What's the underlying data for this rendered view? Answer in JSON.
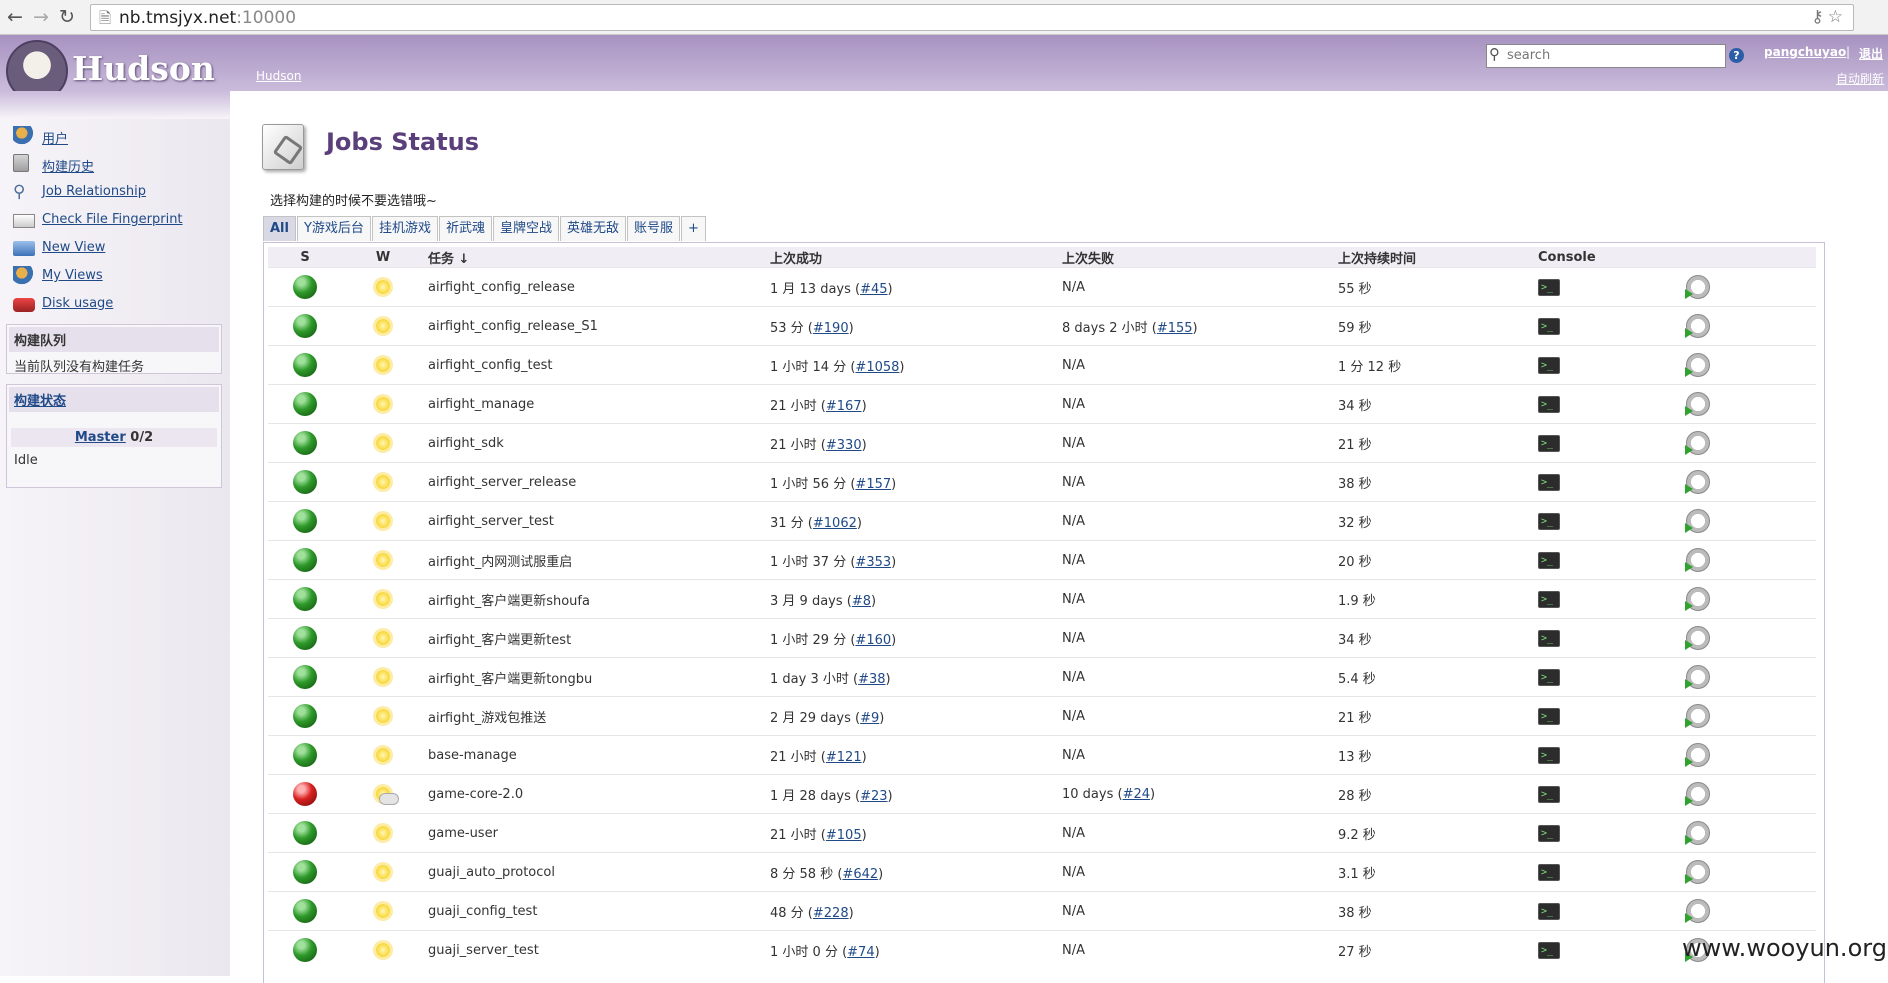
{
  "browser": {
    "url_host": "nb.tmsjyx.net",
    "url_port": ":10000"
  },
  "header": {
    "logo_text": "Hudson",
    "breadcrumb": "Hudson",
    "search_placeholder": "search",
    "user": "pangchuyao",
    "separator": "|",
    "logout": "退出",
    "auto_refresh": "自动刷新"
  },
  "sidebar": {
    "tasks": [
      {
        "label": "用户",
        "icon": "users-icon"
      },
      {
        "label": "构建历史",
        "icon": "build-history-icon"
      },
      {
        "label": "Job Relationship",
        "icon": "search-icon"
      },
      {
        "label": "Check File Fingerprint",
        "icon": "fingerprint-icon"
      },
      {
        "label": "New View",
        "icon": "folder-icon"
      },
      {
        "label": "My Views",
        "icon": "users-icon"
      },
      {
        "label": "Disk usage",
        "icon": "disk-icon"
      }
    ],
    "queue": {
      "title": "构建队列",
      "empty": "当前队列没有构建任务"
    },
    "executors": {
      "title": "构建状态",
      "master": "Master",
      "master_count": "0/2",
      "status": "Idle"
    }
  },
  "main": {
    "title": "Jobs Status",
    "description": "选择构建的时候不要选错哦~",
    "tabs": [
      "All",
      "Y游戏后台",
      "挂机游戏",
      "祈武魂",
      "皇牌空战",
      "英雄无敌",
      "账号服",
      "+"
    ],
    "columns": [
      "S",
      "W",
      "任务 ↓",
      "上次成功",
      "上次失败",
      "上次持续时间",
      "Console"
    ],
    "rows": [
      {
        "status": "blue",
        "weather": "sunny",
        "name": "airfight_config_release",
        "success": "1 月 13 days (",
        "success_build": "#45",
        "failure": "N/A",
        "failure_build": "",
        "duration": "55 秒"
      },
      {
        "status": "blue",
        "weather": "sunny",
        "name": "airfight_config_release_S1",
        "success": "53 分 (",
        "success_build": "#190",
        "failure": "8 days 2 小时 (",
        "failure_build": "#155",
        "duration": "59 秒"
      },
      {
        "status": "blue",
        "weather": "sunny",
        "name": "airfight_config_test",
        "success": "1 小时 14 分 (",
        "success_build": "#1058",
        "failure": "N/A",
        "failure_build": "",
        "duration": "1 分 12 秒"
      },
      {
        "status": "blue",
        "weather": "sunny",
        "name": "airfight_manage",
        "success": "21 小时 (",
        "success_build": "#167",
        "failure": "N/A",
        "failure_build": "",
        "duration": "34 秒"
      },
      {
        "status": "blue",
        "weather": "sunny",
        "name": "airfight_sdk",
        "success": "21 小时 (",
        "success_build": "#330",
        "failure": "N/A",
        "failure_build": "",
        "duration": "21 秒"
      },
      {
        "status": "blue",
        "weather": "sunny",
        "name": "airfight_server_release",
        "success": "1 小时 56 分 (",
        "success_build": "#157",
        "failure": "N/A",
        "failure_build": "",
        "duration": "38 秒"
      },
      {
        "status": "blue",
        "weather": "sunny",
        "name": "airfight_server_test",
        "success": "31 分 (",
        "success_build": "#1062",
        "failure": "N/A",
        "failure_build": "",
        "duration": "32 秒"
      },
      {
        "status": "blue",
        "weather": "sunny",
        "name": "airfight_内网测试服重启",
        "success": "1 小时 37 分 (",
        "success_build": "#353",
        "failure": "N/A",
        "failure_build": "",
        "duration": "20 秒"
      },
      {
        "status": "blue",
        "weather": "sunny",
        "name": "airfight_客户端更新shoufa",
        "success": "3 月 9 days (",
        "success_build": "#8",
        "failure": "N/A",
        "failure_build": "",
        "duration": "1.9 秒"
      },
      {
        "status": "blue",
        "weather": "sunny",
        "name": "airfight_客户端更新test",
        "success": "1 小时 29 分 (",
        "success_build": "#160",
        "failure": "N/A",
        "failure_build": "",
        "duration": "34 秒"
      },
      {
        "status": "blue",
        "weather": "sunny",
        "name": "airfight_客户端更新tongbu",
        "success": "1 day 3 小时 (",
        "success_build": "#38",
        "failure": "N/A",
        "failure_build": "",
        "duration": "5.4 秒"
      },
      {
        "status": "blue",
        "weather": "sunny",
        "name": "airfight_游戏包推送",
        "success": "2 月 29 days (",
        "success_build": "#9",
        "failure": "N/A",
        "failure_build": "",
        "duration": "21 秒"
      },
      {
        "status": "blue",
        "weather": "sunny",
        "name": "base-manage",
        "success": "21 小时 (",
        "success_build": "#121",
        "failure": "N/A",
        "failure_build": "",
        "duration": "13 秒"
      },
      {
        "status": "red",
        "weather": "partly-cloudy",
        "name": "game-core-2.0",
        "success": "1 月 28 days (",
        "success_build": "#23",
        "failure": "10 days (",
        "failure_build": "#24",
        "duration": "28 秒"
      },
      {
        "status": "blue",
        "weather": "sunny",
        "name": "game-user",
        "success": "21 小时 (",
        "success_build": "#105",
        "failure": "N/A",
        "failure_build": "",
        "duration": "9.2 秒"
      },
      {
        "status": "blue",
        "weather": "sunny",
        "name": "guaji_auto_protocol",
        "success": "8 分 58 秒 (",
        "success_build": "#642",
        "failure": "N/A",
        "failure_build": "",
        "duration": "3.1 秒"
      },
      {
        "status": "blue",
        "weather": "sunny",
        "name": "guaji_config_test",
        "success": "48 分 (",
        "success_build": "#228",
        "failure": "N/A",
        "failure_build": "",
        "duration": "38 秒"
      },
      {
        "status": "blue",
        "weather": "sunny",
        "name": "guaji_server_test",
        "success": "1 小时 0 分 (",
        "success_build": "#74",
        "failure": "N/A",
        "failure_build": "",
        "duration": "27 秒"
      }
    ]
  },
  "watermark": "www.wooyun.org"
}
